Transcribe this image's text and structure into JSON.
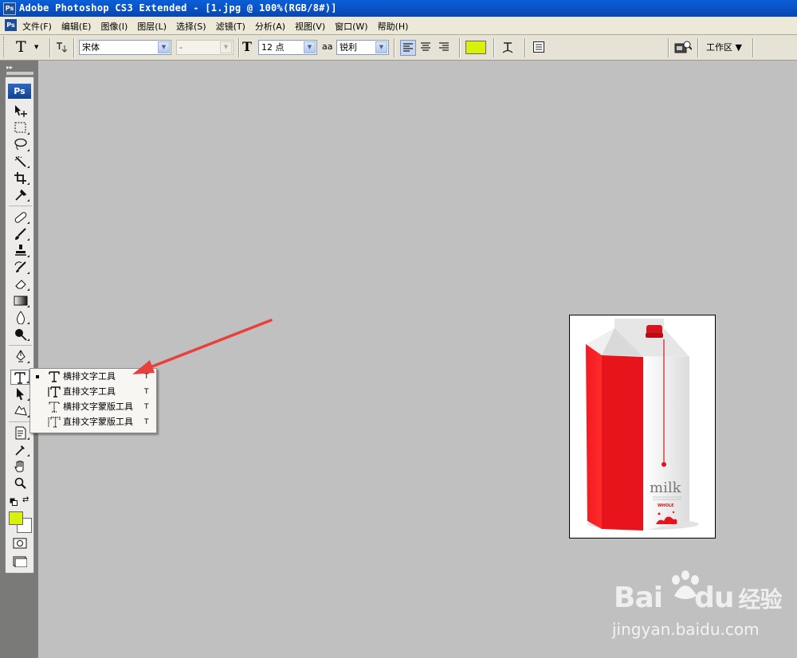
{
  "window": {
    "title": "Adobe Photoshop CS3 Extended - [1.jpg @ 100%(RGB/8#)]",
    "app_badge": "Ps"
  },
  "menu": [
    "文件(F)",
    "编辑(E)",
    "图像(I)",
    "图层(L)",
    "选择(S)",
    "滤镜(T)",
    "分析(A)",
    "视图(V)",
    "窗口(W)",
    "帮助(H)"
  ],
  "options": {
    "tool_glyph": "T",
    "font_family": "宋体",
    "font_style": "-",
    "size_glyph": "T",
    "font_size": "12 点",
    "aa_glyph": "aa",
    "antialias": "锐利",
    "text_color": "#d8f00a",
    "workspace": "工作区 ▼"
  },
  "toolbox": {
    "badge": "Ps",
    "fg_color": "#d8f00a",
    "bg_color": "#ffffff"
  },
  "flyout": {
    "items": [
      {
        "label": "横排文字工具",
        "key": "T",
        "icon": "horizontal-type-icon",
        "selected": true
      },
      {
        "label": "直排文字工具",
        "key": "T",
        "icon": "vertical-type-icon",
        "selected": false
      },
      {
        "label": "横排文字蒙版工具",
        "key": "T",
        "icon": "horizontal-type-mask-icon",
        "selected": false
      },
      {
        "label": "直排文字蒙版工具",
        "key": "T",
        "icon": "vertical-type-mask-icon",
        "selected": false
      }
    ]
  },
  "document": {
    "carton_text": "milk",
    "carton_subtext": "WHOLE",
    "accent": "#e8141c"
  },
  "watermark": {
    "logo_prefix": "Bai",
    "logo_suffix": "du",
    "logo_cn": "经验",
    "url": "jingyan.baidu.com"
  }
}
